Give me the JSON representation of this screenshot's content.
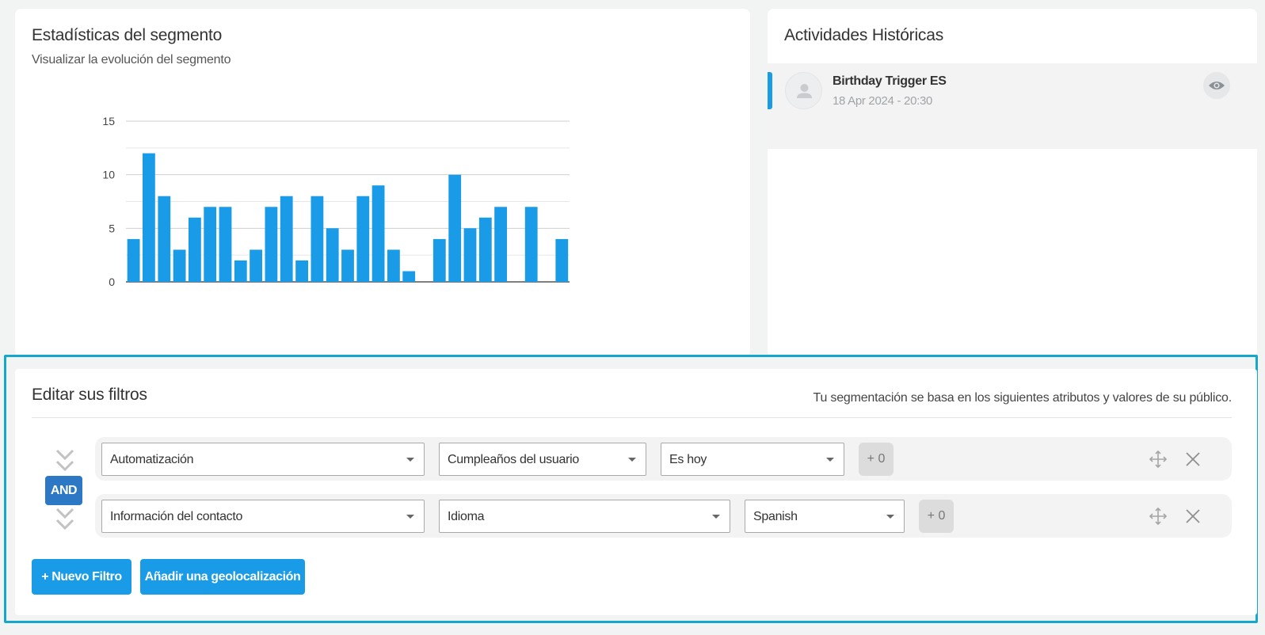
{
  "stats": {
    "title": "Estadísticas del segmento",
    "subtitle": "Visualizar la evolución del segmento"
  },
  "chart_data": {
    "type": "bar",
    "values": [
      4,
      12,
      8,
      3,
      6,
      7,
      7,
      2,
      3,
      7,
      8,
      2,
      8,
      5,
      3,
      8,
      9,
      3,
      1,
      0,
      4,
      10,
      5,
      6,
      7,
      0,
      7,
      0,
      4
    ],
    "yticks": [
      "0",
      "5",
      "10",
      "15"
    ],
    "ylim": [
      0,
      15
    ],
    "bar_color": "#1a9be8",
    "grid": true
  },
  "activities": {
    "title": "Actividades Históricas",
    "items": [
      {
        "name": "Birthday Trigger ES",
        "date": "18 Apr 2024 - 20:30"
      }
    ]
  },
  "filters": {
    "title": "Editar sus filtros",
    "description": "Tu segmentación se basa en los siguientes atributos y valores de su público.",
    "operator": "AND",
    "rows": [
      {
        "category": "Automatización",
        "attribute": "Cumpleaños del usuario",
        "value": "Es hoy",
        "extra": "+ 0"
      },
      {
        "category": "Información del contacto",
        "attribute": "Idioma",
        "value": "Spanish",
        "extra": "+ 0"
      }
    ],
    "buttons": {
      "new_filter": "+ Nuevo Filtro",
      "add_geo": "Añadir una geolocalización"
    }
  },
  "colors": {
    "accent": "#1a9be8",
    "frame": "#16a8cc",
    "and_badge": "#2d78c4"
  }
}
